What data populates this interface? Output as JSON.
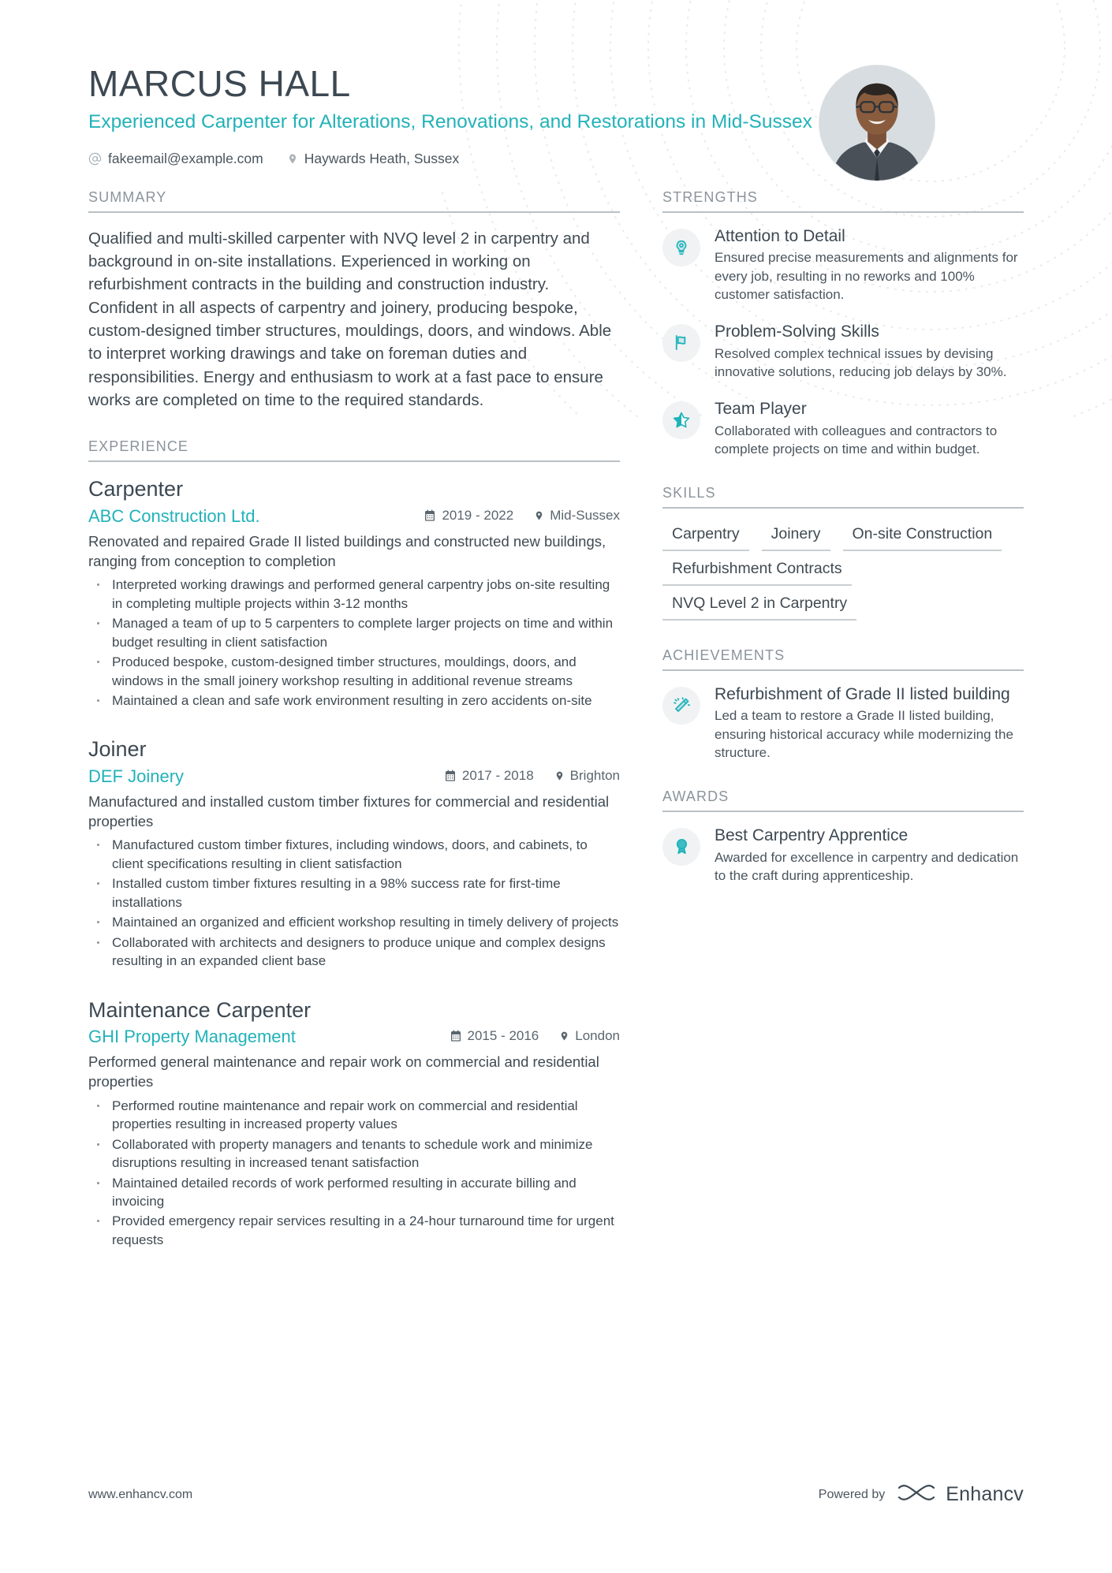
{
  "theme": {
    "accent": "#22b2b9",
    "heading": "#3c4852",
    "muted": "#8a949b",
    "body": "#3f4a52"
  },
  "header": {
    "name": "MARCUS HALL",
    "headline": "Experienced Carpenter for Alterations, Renovations, and Restorations in Mid-Sussex",
    "email": "fakeemail@example.com",
    "location": "Haywards Heath, Sussex",
    "email_icon": "at-icon",
    "location_icon": "map-pin-icon",
    "avatar_icon": "profile-photo"
  },
  "summary": {
    "title": "SUMMARY",
    "text": "Qualified and multi-skilled carpenter with NVQ level 2 in carpentry and background in on-site installations. Experienced in working on refurbishment contracts in the building and construction industry. Confident in all aspects of carpentry and joinery, producing bespoke, custom-designed timber structures, mouldings, doors, and windows. Able to interpret working drawings and take on foreman duties and responsibilities. Energy and enthusiasm to work at a fast pace to ensure works are completed on time to the required standards."
  },
  "experience": {
    "title": "EXPERIENCE",
    "jobs": [
      {
        "role": "Carpenter",
        "company": "ABC Construction Ltd.",
        "dates": "2019 - 2022",
        "location": "Mid-Sussex",
        "description": "Renovated and repaired Grade II listed buildings and constructed new buildings, ranging from conception to completion",
        "bullets": [
          "Interpreted working drawings and performed general carpentry jobs on-site resulting in completing multiple projects within 3-12 months",
          "Managed a team of up to 5 carpenters to complete larger projects on time and within budget resulting in client satisfaction",
          "Produced bespoke, custom-designed timber structures, mouldings, doors, and windows in the small joinery workshop resulting in additional revenue streams",
          "Maintained a clean and safe work environment resulting in zero accidents on-site"
        ]
      },
      {
        "role": "Joiner",
        "company": "DEF Joinery",
        "dates": "2017 - 2018",
        "location": "Brighton",
        "description": "Manufactured and installed custom timber fixtures for commercial and residential properties",
        "bullets": [
          "Manufactured custom timber fixtures, including windows, doors, and cabinets, to client specifications resulting in client satisfaction",
          "Installed custom timber fixtures resulting in a 98% success rate for first-time installations",
          "Maintained an organized and efficient workshop resulting in timely delivery of projects",
          "Collaborated with architects and designers to produce unique and complex designs resulting in an expanded client base"
        ]
      },
      {
        "role": "Maintenance Carpenter",
        "company": "GHI Property Management",
        "dates": "2015 - 2016",
        "location": "London",
        "description": "Performed general maintenance and repair work on commercial and residential properties",
        "bullets": [
          "Performed routine maintenance and repair work on commercial and residential properties resulting in increased property values",
          "Collaborated with property managers and tenants to schedule work and minimize disruptions resulting in increased tenant satisfaction",
          "Maintained detailed records of work performed resulting in accurate billing and invoicing",
          "Provided emergency repair services resulting in a 24-hour turnaround time for urgent requests"
        ]
      }
    ]
  },
  "strengths": {
    "title": "STRENGTHS",
    "items": [
      {
        "icon": "lightbulb-icon",
        "title": "Attention to Detail",
        "desc": "Ensured precise measurements and alignments for every job, resulting in no reworks and 100% customer satisfaction."
      },
      {
        "icon": "flag-icon",
        "title": "Problem-Solving Skills",
        "desc": "Resolved complex technical issues by devising innovative solutions, reducing job delays by 30%."
      },
      {
        "icon": "star-icon",
        "title": "Team Player",
        "desc": "Collaborated with colleagues and contractors to complete projects on time and within budget."
      }
    ]
  },
  "skills": {
    "title": "SKILLS",
    "items": [
      "Carpentry",
      "Joinery",
      "On-site Construction",
      "Refurbishment Contracts",
      "NVQ Level 2 in Carpentry"
    ]
  },
  "achievements": {
    "title": "ACHIEVEMENTS",
    "items": [
      {
        "icon": "magic-wand-icon",
        "title": "Refurbishment of Grade II listed building",
        "desc": "Led a team to restore a Grade II listed building, ensuring historical accuracy while modernizing the structure."
      }
    ]
  },
  "awards": {
    "title": "AWARDS",
    "items": [
      {
        "icon": "award-medal-icon",
        "title": "Best Carpentry Apprentice",
        "desc": "Awarded for excellence in carpentry and dedication to the craft during apprenticeship."
      }
    ]
  },
  "footer": {
    "url": "www.enhancv.com",
    "powered_by": "Powered by",
    "brand": "Enhancv",
    "brand_icon": "enhancv-logo-icon"
  }
}
